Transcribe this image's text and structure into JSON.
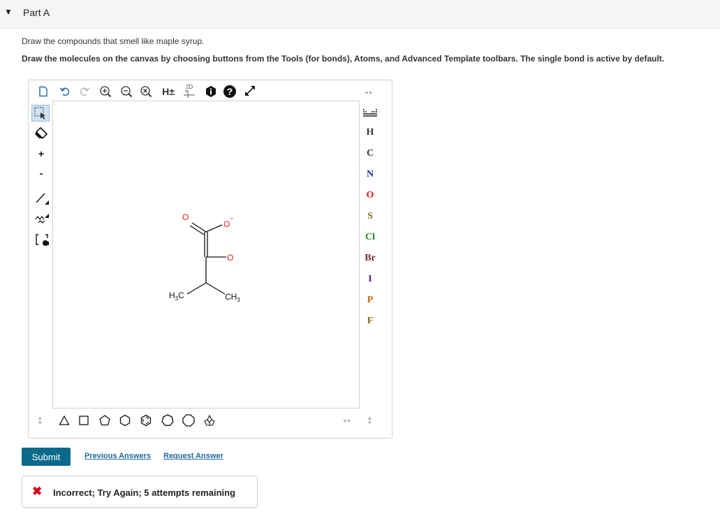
{
  "part": {
    "title": "Part A",
    "caret": "▼"
  },
  "question": {
    "text": "Draw the compounds that smell like maple syrup.",
    "instructions": "Draw the molecules on the canvas by choosing buttons from the Tools (for bonds), Atoms, and Advanced Template toolbars. The single bond is active by default."
  },
  "toolbar": {
    "h_toggle_label": "H±",
    "clean_label": "2D",
    "help_label": "?"
  },
  "side_tools": {
    "plus_label": "+",
    "minus_label": "-"
  },
  "atoms": [
    {
      "symbol": "H",
      "color": "#333333"
    },
    {
      "symbol": "C",
      "color": "#333333"
    },
    {
      "symbol": "N",
      "color": "#1f2f8f"
    },
    {
      "symbol": "O",
      "color": "#e01a1a"
    },
    {
      "symbol": "S",
      "color": "#7a6d1a"
    },
    {
      "symbol": "Cl",
      "color": "#1f8a1f"
    },
    {
      "symbol": "Br",
      "color": "#7a2f2f"
    },
    {
      "symbol": "I",
      "color": "#6b1f8f"
    },
    {
      "symbol": "P",
      "color": "#c06a10"
    },
    {
      "symbol": "F",
      "color": "#7a6d1a"
    }
  ],
  "molecule": {
    "carbonyl_o": "O",
    "oxide_o": "O",
    "oxide_charge": "-",
    "keto_o": "O",
    "left_methyl": {
      "h": "H",
      "sub": "3",
      "c": "C"
    },
    "right_methyl": {
      "c": "CH",
      "sub": "3"
    }
  },
  "actions": {
    "submit": "Submit",
    "previous_answers": "Previous Answers",
    "request_answer": "Request Answer"
  },
  "feedback": {
    "icon": "✖",
    "message": "Incorrect; Try Again; 5 attempts remaining"
  },
  "colors": {
    "accent": "#0a6a8a",
    "link": "#1e6aa0",
    "error": "#d0021b",
    "oxygen": "#e01a1a"
  }
}
